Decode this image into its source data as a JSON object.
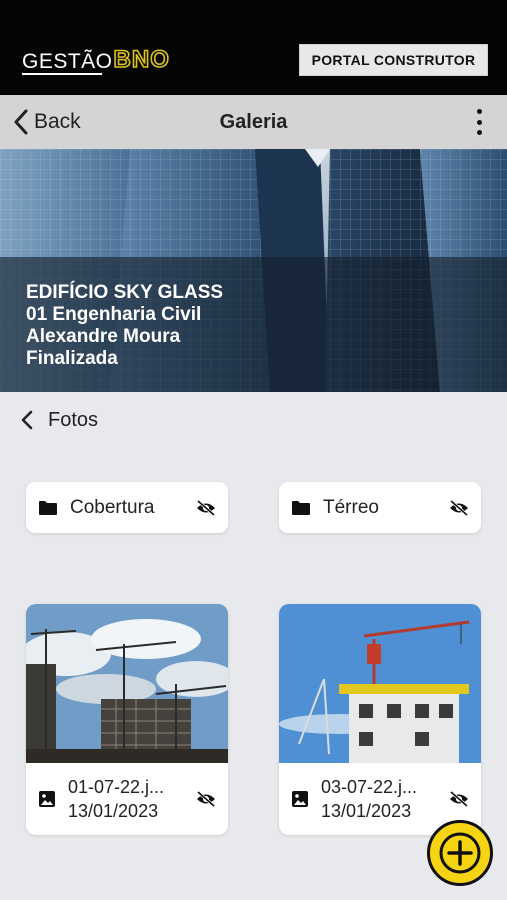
{
  "header": {
    "logo_text_main": "GESTÃO",
    "logo_text_accent": "BNO",
    "portal_button": "PORTAL CONSTRUTOR"
  },
  "navbar": {
    "back_label": "Back",
    "title": "Galeria"
  },
  "hero": {
    "line1": "EDIFÍCIO SKY GLASS",
    "line2": "01 Engenharia Civil",
    "line3": "Alexandre Moura",
    "line4": "Finalizada"
  },
  "section": {
    "title": "Fotos"
  },
  "folders": [
    {
      "label": "Cobertura",
      "icon": "folder-icon",
      "visibility_icon": "eye-off-icon"
    },
    {
      "label": "Térreo",
      "icon": "folder-icon",
      "visibility_icon": "eye-off-icon"
    }
  ],
  "photos": [
    {
      "filename": "01-07-22.j...",
      "date": "13/01/2023",
      "icon": "image-icon",
      "visibility_icon": "eye-off-icon"
    },
    {
      "filename": "03-07-22.j...",
      "date": "13/01/2023",
      "icon": "image-icon",
      "visibility_icon": "eye-off-icon"
    }
  ],
  "fab": {
    "icon": "plus-icon"
  },
  "colors": {
    "topbar": "#050505",
    "navbar": "#d4d4d4",
    "background": "#e8e9ec",
    "accent_yellow": "#f6d411",
    "logo_accent": "#d9c11a"
  }
}
